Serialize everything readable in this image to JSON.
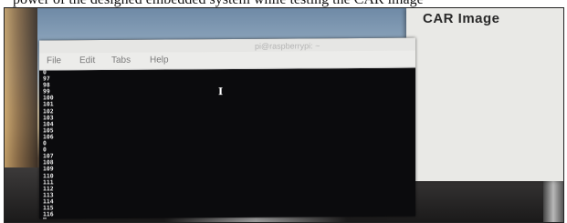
{
  "caption_text": "power of the designed embedded system while testing the CAR image",
  "car_window": {
    "title": "CAR Image"
  },
  "terminal": {
    "title": "pi@raspberrypi: ~",
    "menu": [
      "File",
      "Edit",
      "Tabs",
      "Help"
    ],
    "lines": [
      "0",
      "97",
      "98",
      "99",
      "100",
      "101",
      "102",
      "103",
      "104",
      "105",
      "106",
      "0",
      "0",
      "107",
      "108",
      "109",
      "110",
      "111",
      "112",
      "113",
      "114",
      "115",
      "116"
    ],
    "cursor_icon": "text-cursor-ibeam-icon",
    "ibeam_glyph": "I"
  }
}
